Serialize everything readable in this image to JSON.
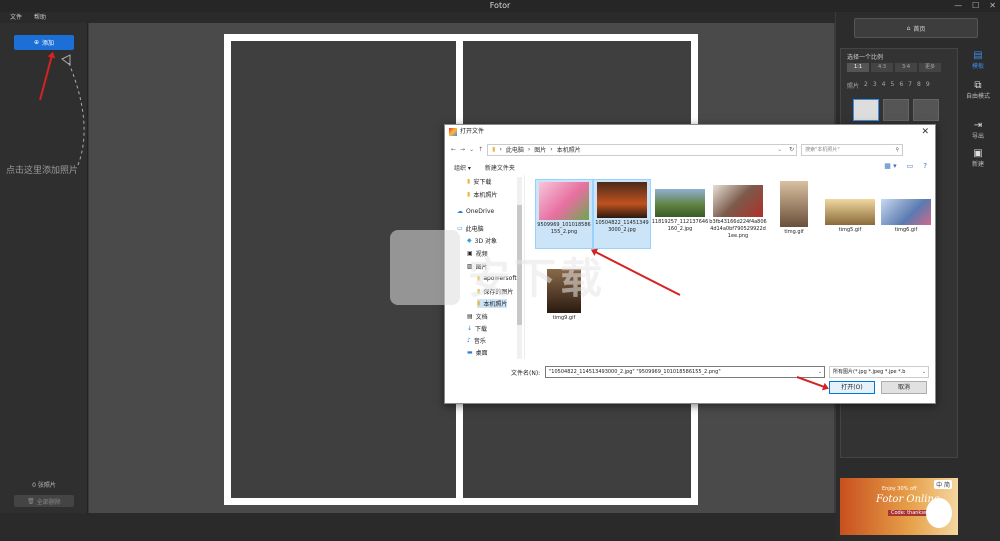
{
  "app": {
    "title": "Fotor",
    "menu": [
      "文件",
      "帮助"
    ]
  },
  "left": {
    "add_label": "添加",
    "hint": "点击这里添加照片",
    "photo_count": "0 张照片",
    "clear_label": "全部删除"
  },
  "right": {
    "home_label": "首页",
    "panel_title": "选择一个比例",
    "ratios": [
      "1:1",
      "4:3",
      "3:4",
      "更多"
    ],
    "count_label": "照片",
    "counts": [
      "2",
      "3",
      "4",
      "5",
      "6",
      "7",
      "8",
      "9"
    ],
    "tools": [
      {
        "label": "模板",
        "icon": "template-icon"
      },
      {
        "label": "自由模式",
        "icon": "freestyle-icon"
      },
      {
        "label": "导出",
        "icon": "export-icon"
      },
      {
        "label": "新建",
        "icon": "new-icon"
      }
    ],
    "ad": {
      "line1": "Enjoy 30% off",
      "line2": "Fotor Online",
      "line3": "Code: thankswin",
      "lang": "中 简"
    }
  },
  "dialog": {
    "title": "打开文件",
    "breadcrumb": [
      "此电脑",
      "图片",
      "本机照片"
    ],
    "search_placeholder": "搜索\"本机照片\"",
    "organize": "组织 ▾",
    "new_folder": "新建文件夹",
    "nav": [
      {
        "label": "安下载",
        "icon": "folder-icon"
      },
      {
        "label": "本机照片",
        "icon": "folder-icon"
      },
      {
        "label": "OneDrive",
        "icon": "cloud-icon"
      },
      {
        "label": "此电脑",
        "icon": "pc-icon"
      },
      {
        "label": "3D 对象",
        "icon": "cube-icon"
      },
      {
        "label": "视频",
        "icon": "video-icon"
      },
      {
        "label": "图片",
        "icon": "picture-icon"
      },
      {
        "label": "apowersoft",
        "icon": "folder-icon"
      },
      {
        "label": "保存的图片",
        "icon": "folder-icon"
      },
      {
        "label": "本机照片",
        "icon": "folder-icon"
      },
      {
        "label": "文档",
        "icon": "document-icon"
      },
      {
        "label": "下载",
        "icon": "download-icon"
      },
      {
        "label": "音乐",
        "icon": "music-icon"
      },
      {
        "label": "桌面",
        "icon": "desktop-icon"
      }
    ],
    "files": [
      {
        "name": "9509969_101018586155_2.png",
        "selected": true,
        "color": "#e86fa0"
      },
      {
        "name": "10504822_114513493000_2.jpg",
        "selected": true,
        "color": "#7a3a1a"
      },
      {
        "name": "11819257_112137646160_2.jpg",
        "selected": false,
        "color": "#5d7f3a"
      },
      {
        "name": "b3fb43166d224f4a8064d14a0bf790529922d1ee.png",
        "selected": false,
        "color": "#7b5a4a"
      },
      {
        "name": "timg.gif",
        "selected": false,
        "color": "#6a4f3a"
      },
      {
        "name": "timg5.gif",
        "selected": false,
        "color": "#8a6a3a"
      },
      {
        "name": "timg6.gif",
        "selected": false,
        "color": "#5a7ab0"
      },
      {
        "name": "timg9.gif",
        "selected": false,
        "color": "#4a3a2a"
      }
    ],
    "filename_label": "文件名(N):",
    "filename_value": "\"10504822_114513493000_2.jpg\" \"9509969_101018586155_2.png\"",
    "filter_value": "所有图片(*.jpg *.jpeg *.jpe *.b",
    "open_label": "打开(O)",
    "cancel_label": "取消"
  },
  "watermark": {
    "text": "安下载"
  },
  "colors": {
    "accent": "#1c6fd6",
    "arrow": "#d62222"
  }
}
